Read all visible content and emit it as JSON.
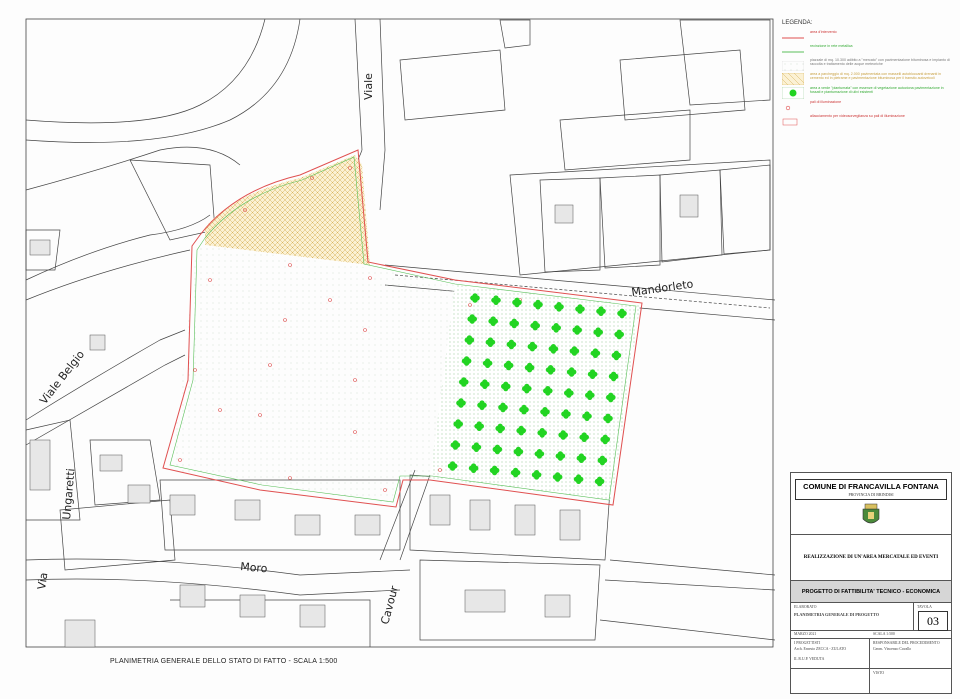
{
  "legend": {
    "title": "LEGENDA:",
    "items": [
      {
        "symbol": "red-line",
        "text": "area d'intervento"
      },
      {
        "symbol": "green-line",
        "text": "recinzione in rete metallica"
      },
      {
        "symbol": "dotted",
        "text": "piazzale di mq. 10.300 adibito a \"mercato\" con pavimentazione bituminosa e impianto di raccolta e trattamento delle acque meteoriche"
      },
      {
        "symbol": "ochre-hatch",
        "text": "area a parcheggio di mq. 2.000 pavimentata con masselli autobloccanti drenanti in cemento ed in pietrame e pavimentazione bituminosa per il transito autoveicoli"
      },
      {
        "symbol": "green-tree",
        "text": "area a verde \"piantumata\" con essenze di vegetazione autoctona pavimentazione in fossati e piantumazione di ulivi esistenti"
      },
      {
        "symbol": "red-dot",
        "text": "pali di illuminazione"
      },
      {
        "symbol": "red-code",
        "text": "allacciamento per videosorveglianza su pali di illuminazione"
      }
    ]
  },
  "streets": [
    "Viale",
    "Mandorleto",
    "Viale Belgio",
    "Ungaretti",
    "Moro",
    "Cavour",
    "Via"
  ],
  "plan_title": "PLANIMETRIA GENERALE DELLO STATO DI FATTO - SCALA 1:500",
  "title_block": {
    "comune": "COMUNE DI FRANCAVILLA FONTANA",
    "provincia": "PROVINCIA DI BRINDISI",
    "opera": "REALIZZAZIONE DI UN'AREA MERCATALE ED EVENTI",
    "progetto": "PROGETTO DI FATTIBILITA' TECNICO - ECONOMICA",
    "elaborato_label": "ELABORATO",
    "elaborato": "PLANIMETRIA GENERALE DI PROGETTO",
    "tavola_label": "TAVOLA",
    "tavola": "03",
    "data": "MARZO 2021",
    "scala": "SCALA 1:500",
    "progettista_label": "I PROGETTISTI",
    "progettista": "Arch. Ernesto ZECCA - ZULATO",
    "rup_label": "RESPONSABILE DEL PROCEDIMENTO",
    "rup": "Geom. Vincenzo Cavallo",
    "visto": "VISTO",
    "firma": "IL R.U.P. VEDUTA"
  },
  "colors": {
    "boundary": "#e05050",
    "fence": "#5ac05a",
    "trees": "#22d422",
    "hatch": "#d9b560",
    "lines": "#333333"
  }
}
